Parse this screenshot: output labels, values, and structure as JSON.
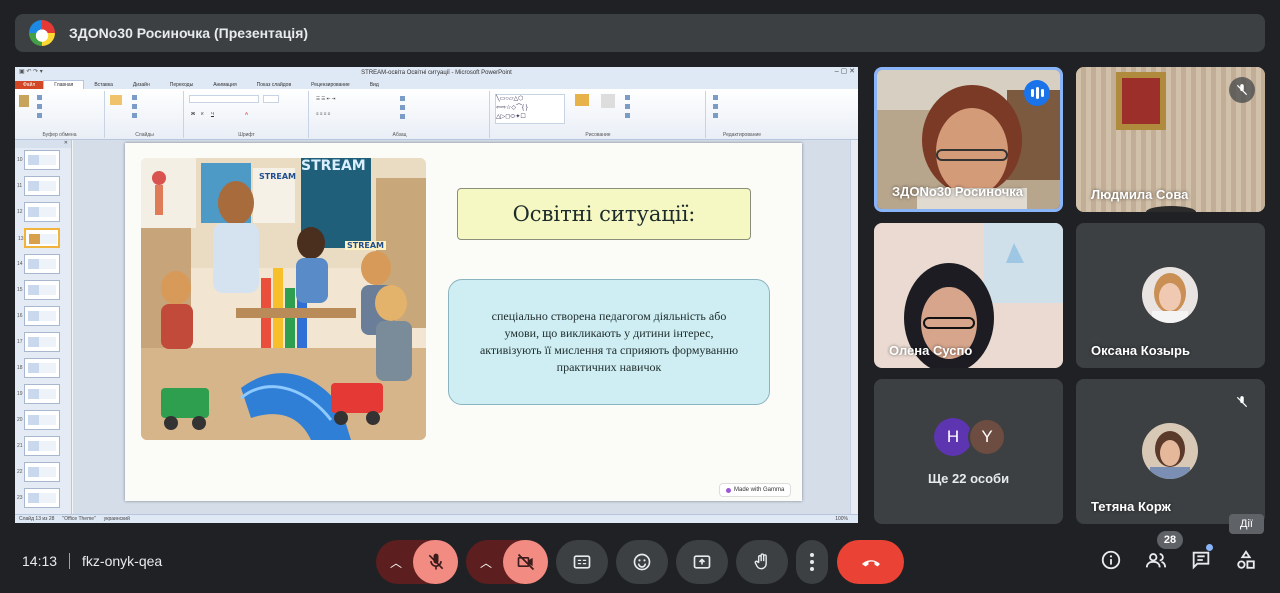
{
  "meeting": {
    "title": "ЗДОNo30 Росиночка (Презентація)",
    "time": "14:13",
    "code": "fkz-onyk-qea",
    "participant_count": "28",
    "actions_tooltip": "Дії"
  },
  "powerpoint": {
    "window_title": "STREAM-освіта Освітні ситуації - Microsoft PowerPoint",
    "tabs": [
      "Файл",
      "Главная",
      "Вставка",
      "Дизайн",
      "Переходы",
      "Анимация",
      "Показ слайдов",
      "Рецензирование",
      "Вид"
    ],
    "ribbon_groups": [
      "Буфер обмена",
      "Слайды",
      "Шрифт",
      "Абзац",
      "Рисование",
      "Редактирование"
    ],
    "status_slide": "Слайд 13 из 28",
    "status_theme": "\"Office Theme\"",
    "status_lang": "украинский",
    "zoom": "100%",
    "thumb_numbers": [
      "10",
      "11",
      "12",
      "13",
      "14",
      "15",
      "16",
      "17",
      "18",
      "19",
      "20",
      "21",
      "22",
      "23"
    ]
  },
  "slide": {
    "heading": "Освітні ситуації:",
    "body": "спеціально створена педагогом діяльність або умови, що викликають у дитини інтерес, активізують її мислення та сприяють формуванню практичних навичок",
    "badge": "Made with Gamma",
    "photo_sign_1": "STREAM",
    "photo_sign_2": "STREAM",
    "photo_sign_3": "STREAM"
  },
  "participants": [
    {
      "name": "ЗДОNo30 Росиночка",
      "speaking": true
    },
    {
      "name": "Людмила Сова",
      "muted": true
    },
    {
      "name": "Олена Суспо"
    },
    {
      "name": "Оксана Козырь"
    },
    {
      "name": "Ще 22 особи",
      "initials": [
        "Н",
        "Y"
      ]
    },
    {
      "name": "Тетяна Корж",
      "muted": true
    }
  ],
  "colors": {
    "meet_bg": "#202124",
    "tile_bg": "#3c4043",
    "hangup": "#ea4335",
    "mic_off": "#f28b82",
    "speaking_blue": "#1a73e8"
  },
  "icons": {
    "mic": "mic-off-icon",
    "camera": "camera-off-icon",
    "captions": "captions-icon",
    "emoji": "emoji-icon",
    "present": "present-icon",
    "hand": "raise-hand-icon",
    "more": "more-vert-icon",
    "hangup": "call-end-icon",
    "info": "info-icon",
    "people": "people-icon",
    "chat": "chat-icon",
    "activities": "activities-icon"
  }
}
